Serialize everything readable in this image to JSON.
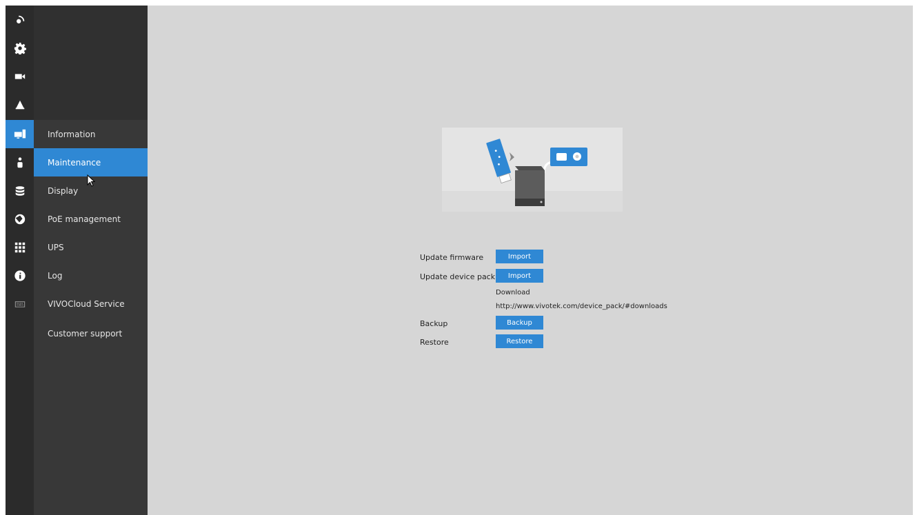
{
  "iconbar": {
    "items": [
      {
        "icon": "liveview-icon"
      },
      {
        "icon": "gear-icon"
      },
      {
        "icon": "camera-icon"
      },
      {
        "icon": "bell-icon"
      },
      {
        "icon": "system-icon"
      },
      {
        "icon": "user-icon"
      },
      {
        "icon": "storage-icon"
      },
      {
        "icon": "network-icon"
      },
      {
        "icon": "apps-icon"
      },
      {
        "icon": "info-icon"
      },
      {
        "icon": "keyboard-icon"
      }
    ]
  },
  "submenu": {
    "items": [
      {
        "label": "Information"
      },
      {
        "label": "Maintenance"
      },
      {
        "label": "Display"
      },
      {
        "label": "PoE management"
      },
      {
        "label": "UPS"
      },
      {
        "label": "Log"
      },
      {
        "label": "VIVOCloud Service"
      },
      {
        "label": "Customer support"
      }
    ],
    "active_index": 1
  },
  "maintenance": {
    "update_firmware_label": "Update firmware",
    "update_firmware_button": "Import",
    "update_device_pack_label": "Update device pack",
    "update_device_pack_button": "Import",
    "download_label": "Download",
    "download_url": "http://www.vivotek.com/device_pack/#downloads",
    "backup_label": "Backup",
    "backup_button": "Backup",
    "restore_label": "Restore",
    "restore_button": "Restore"
  },
  "colors": {
    "accent": "#2f88d4",
    "iconbar_bg": "#2b2b2b",
    "submenu_bg": "#383838",
    "content_bg": "#d6d6d6"
  }
}
